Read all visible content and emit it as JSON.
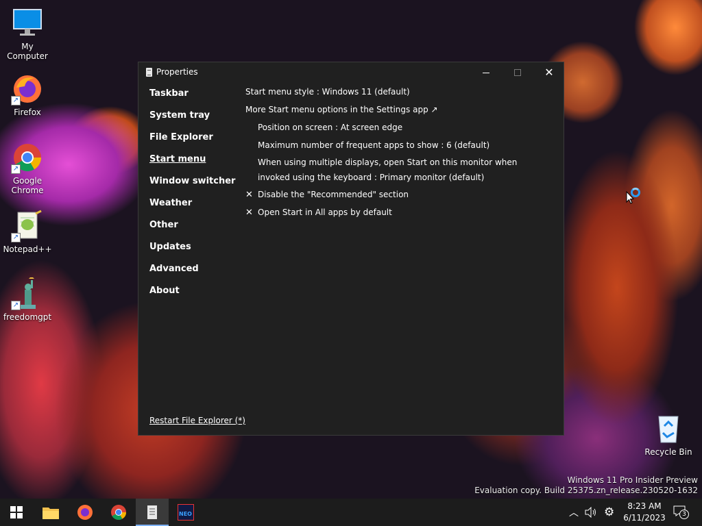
{
  "desktop": {
    "icons": [
      {
        "label": "My Computer"
      },
      {
        "label": "Firefox"
      },
      {
        "label": "Google Chrome"
      },
      {
        "label": "Notepad++"
      },
      {
        "label": "freedomgpt"
      },
      {
        "label": "Recycle Bin"
      }
    ],
    "watermark": {
      "line1": "Windows 11 Pro Insider Preview",
      "line2": "Evaluation copy. Build 25375.zn_release.230520-1632"
    }
  },
  "window": {
    "title": "Properties",
    "nav": [
      {
        "label": "Taskbar"
      },
      {
        "label": "System tray"
      },
      {
        "label": "File Explorer"
      },
      {
        "label": "Start menu",
        "active": true
      },
      {
        "label": "Window switcher"
      },
      {
        "label": "Weather"
      },
      {
        "label": "Other"
      },
      {
        "label": "Updates"
      },
      {
        "label": "Advanced"
      },
      {
        "label": "About"
      }
    ],
    "settings": {
      "start_menu_style": "Start menu style : Windows 11 (default)",
      "more_options_link": "More Start menu options in the Settings app ↗",
      "position": "Position on screen : At screen edge",
      "max_frequent": "Maximum number of frequent apps to show : 6 (default)",
      "multi_display": "When using multiple displays, open Start on this monitor when invoked using the keyboard : Primary monitor (default)",
      "disable_recommended": "Disable the \"Recommended\" section",
      "open_all_apps": "Open Start in All apps by default",
      "check_glyph": "✕"
    },
    "restart_link": "Restart File Explorer (*)"
  },
  "taskbar": {
    "apps": [
      "start-icon",
      "file-explorer-icon",
      "firefox-icon",
      "chrome-icon",
      "properties-app-icon",
      "neo-app-icon"
    ],
    "neo_label": "NEO",
    "time": "8:23 AM",
    "date": "6/11/2023",
    "notification_count": "3"
  },
  "colors": {
    "window_bg": "#202020",
    "taskbar_bg": "#1c1c1c",
    "accent": "#2a9bf0"
  }
}
